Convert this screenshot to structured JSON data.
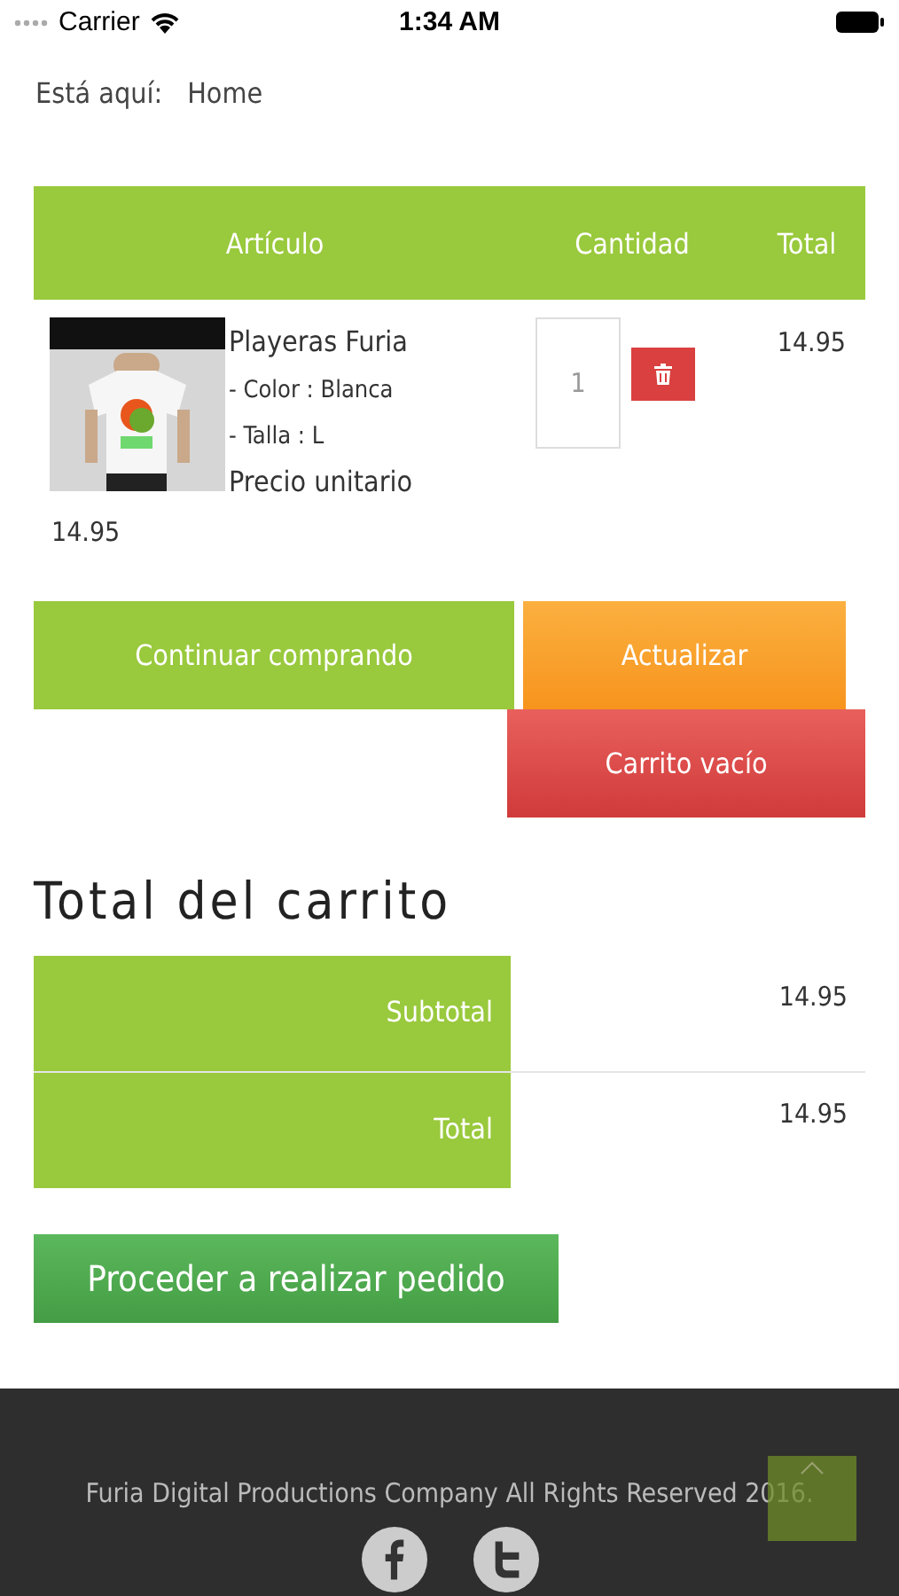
{
  "status_bar": {
    "carrier": "Carrier",
    "time": "1:34 AM"
  },
  "breadcrumb": {
    "label": "Está aquí:",
    "link": "Home"
  },
  "cart_table": {
    "columns": [
      "Artículo",
      "Cantidad",
      "Total"
    ],
    "rows": [
      {
        "image": {
          "kind": "picture"
        },
        "name": "Playeras Furia",
        "options": [
          "- Color : Blanca",
          "- Talla : L"
        ],
        "unit_price_label": "Precio unitario",
        "unit_price": "14.95",
        "quantity": "1",
        "total": "14.95"
      }
    ]
  },
  "buttons": {
    "continue": "Continuar comprando",
    "update": "Actualizar",
    "empty": "Carrito vacío"
  },
  "cart_totals": {
    "title": "Total del carrito",
    "rows": [
      {
        "label": "Subtotal",
        "value": "14.95"
      },
      {
        "label": "Total",
        "value": "14.95"
      }
    ]
  },
  "checkout_button": "Proceder a realizar pedido",
  "footer": {
    "copyright": "Furia Digital Productions Company All Rights Reserved 2016."
  }
}
